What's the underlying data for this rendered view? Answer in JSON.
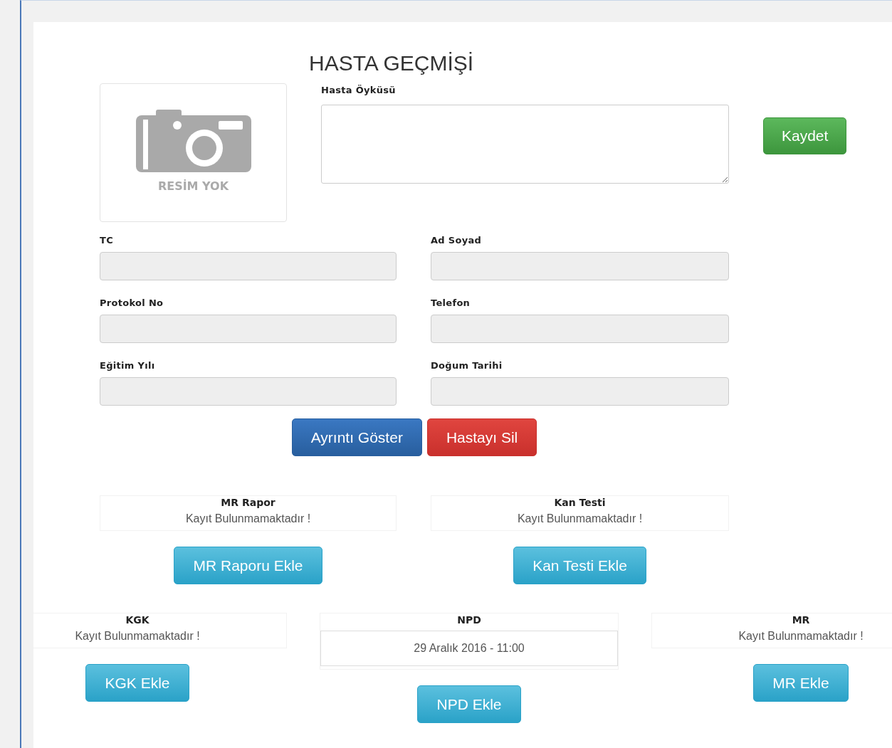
{
  "title": "HASTA GEÇMİŞİ",
  "photo": {
    "caption": "RESİM YOK"
  },
  "history": {
    "label": "Hasta Öyküsü"
  },
  "save_button": "Kaydet",
  "fields": [
    {
      "label": "TC",
      "disabled": true
    },
    {
      "label": "Ad Soyad",
      "disabled": true
    },
    {
      "label": "Protokol No",
      "disabled": true
    },
    {
      "label": "Telefon",
      "disabled": true
    },
    {
      "label": "Eğitim Yılı",
      "disabled": true
    },
    {
      "label": "Doğum Tarihi",
      "disabled": true
    }
  ],
  "actions": [
    {
      "label": "Ayrıntı Göster",
      "kind": "primary"
    },
    {
      "label": "Hastayı Sil",
      "kind": "danger"
    }
  ],
  "records_top": [
    {
      "title": "MR Rapor",
      "kind": "empty",
      "status": "Kayıt Bulunmamaktadır !",
      "button": "MR Raporu Ekle"
    },
    {
      "title": "Kan Testi",
      "kind": "empty",
      "status": "Kayıt Bulunmamaktadır !",
      "button": "Kan Testi Ekle"
    }
  ],
  "records_bottom": [
    {
      "title": "KGK",
      "kind": "empty",
      "status": "Kayıt Bulunmamaktadır !",
      "button": "KGK Ekle"
    },
    {
      "title": "NPD",
      "kind": "entry",
      "status": "29 Aralık 2016 - 11:00",
      "button": "NPD Ekle"
    },
    {
      "title": "MR",
      "kind": "empty",
      "status": "Kayıt Bulunmamaktadır !",
      "button": "MR Ekle"
    }
  ]
}
